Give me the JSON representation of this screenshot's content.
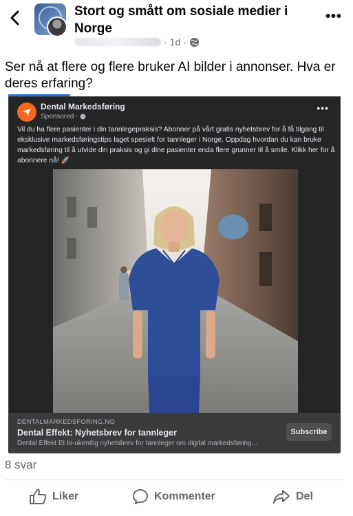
{
  "header": {
    "group_name": "Stort og smått om sosiale medier i Norge",
    "post_age": "1d",
    "separator": "·",
    "back_icon": "chevron-left-icon",
    "more_icon": "more-horizontal-icon",
    "more_symbol": "•••"
  },
  "post": {
    "text": "Ser nå at flere og flere bruker AI bilder i annonser. Hva er deres erfaring?"
  },
  "ad": {
    "page_name": "Dental Markedsføring",
    "sponsored_label": "Sponsored ·",
    "more_symbol": "•••",
    "body": "Vil du ha flere pasienter i din tannlegepraksis? Abonner på vårt gratis nyhetsbrev for å få tilgang til eksklusive markedsføringstips laget spesielt for tannleger i Norge. Oppdag hvordan du kan bruke markedsføring til å utvide din praksis og gi dine pasienter enda flere grunner til å smile. Klikk her for å abonnere nå! 🚀",
    "link_domain": "DENTALMARKEDSFORING.NO",
    "link_title": "Dental Effekt: Nyhetsbrev for tannleger",
    "link_description": "Dental Effekt Et bi-ukentlig nyhetsbrev for tannleger om digital markedsføring...",
    "cta_label": "Subscribe",
    "accent_color": "#f26a22"
  },
  "footer": {
    "reply_count": "8 svar",
    "like_label": "Liker",
    "comment_label": "Kommenter",
    "share_label": "Del"
  },
  "colors": {
    "accent_blue": "#1877f2",
    "ad_background": "#242526",
    "secondary_text": "#65676b"
  }
}
